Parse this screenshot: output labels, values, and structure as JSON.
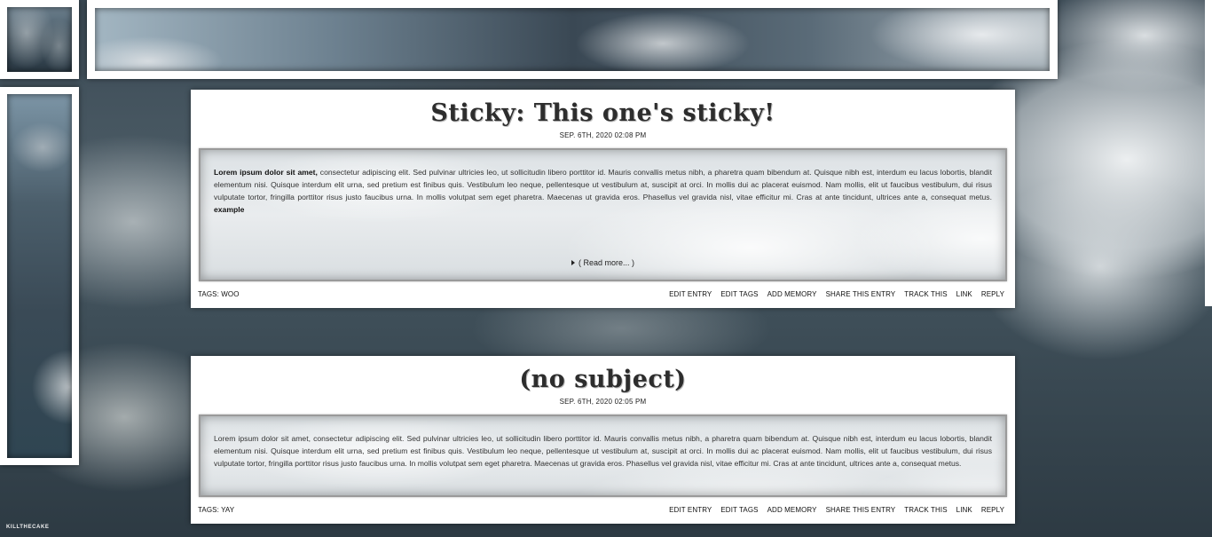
{
  "entries": [
    {
      "title": "Sticky: This one's sticky!",
      "date": "SEP. 6TH, 2020 02:08 PM",
      "body_lead": "Lorem ipsum dolor sit amet,",
      "body_text": " consectetur adipiscing elit. Sed pulvinar ultricies leo, ut sollicitudin libero porttitor id. Mauris convallis metus nibh, a pharetra quam bibendum at. Quisque nibh est, interdum eu lacus lobortis, blandit elementum nisi. Quisque interdum elit urna, sed pretium est finibus quis. Vestibulum leo neque, pellentesque ut vestibulum at, suscipit at orci. In mollis dui ac placerat euismod. Nam mollis, elit ut faucibus vestibulum, dui risus vulputate tortor, fringilla porttitor risus justo faucibus urna. In mollis volutpat sem eget pharetra. Maecenas ut gravida eros. Phasellus vel gravida nisl, vitae efficitur mi. Cras at ante tincidunt, ultrices ante a, consequat metus. ",
      "body_tail": "example",
      "read_more": "( Read more... )",
      "tags": "TAGS: WOO",
      "actions": [
        "EDIT ENTRY",
        "EDIT TAGS",
        "ADD MEMORY",
        "SHARE THIS ENTRY",
        "TRACK THIS",
        "LINK",
        "REPLY"
      ]
    },
    {
      "title": "(no subject)",
      "date": "SEP. 6TH, 2020 02:05 PM",
      "body_text": "Lorem ipsum dolor sit amet, consectetur adipiscing elit. Sed pulvinar ultricies leo, ut sollicitudin libero porttitor id. Mauris convallis metus nibh, a pharetra quam bibendum at. Quisque nibh est, interdum eu lacus lobortis, blandit elementum nisi. Quisque interdum elit urna, sed pretium est finibus quis. Vestibulum leo neque, pellentesque ut vestibulum at, suscipit at orci. In mollis dui ac placerat euismod. Nam mollis, elit ut faucibus vestibulum, dui risus vulputate tortor, fringilla porttitor risus justo faucibus urna. In mollis volutpat sem eget pharetra. Maecenas ut gravida eros. Phasellus vel gravida nisl, vitae efficitur mi. Cras at ante tincidunt, ultrices ante a, consequat metus.",
      "tags": "TAGS: YAY",
      "actions": [
        "EDIT ENTRY",
        "EDIT TAGS",
        "ADD MEMORY",
        "SHARE THIS ENTRY",
        "TRACK THIS",
        "LINK",
        "REPLY"
      ]
    }
  ],
  "credit": "KILLTHECAKE",
  "icons": {
    "read_more": "triangle-right-icon"
  }
}
